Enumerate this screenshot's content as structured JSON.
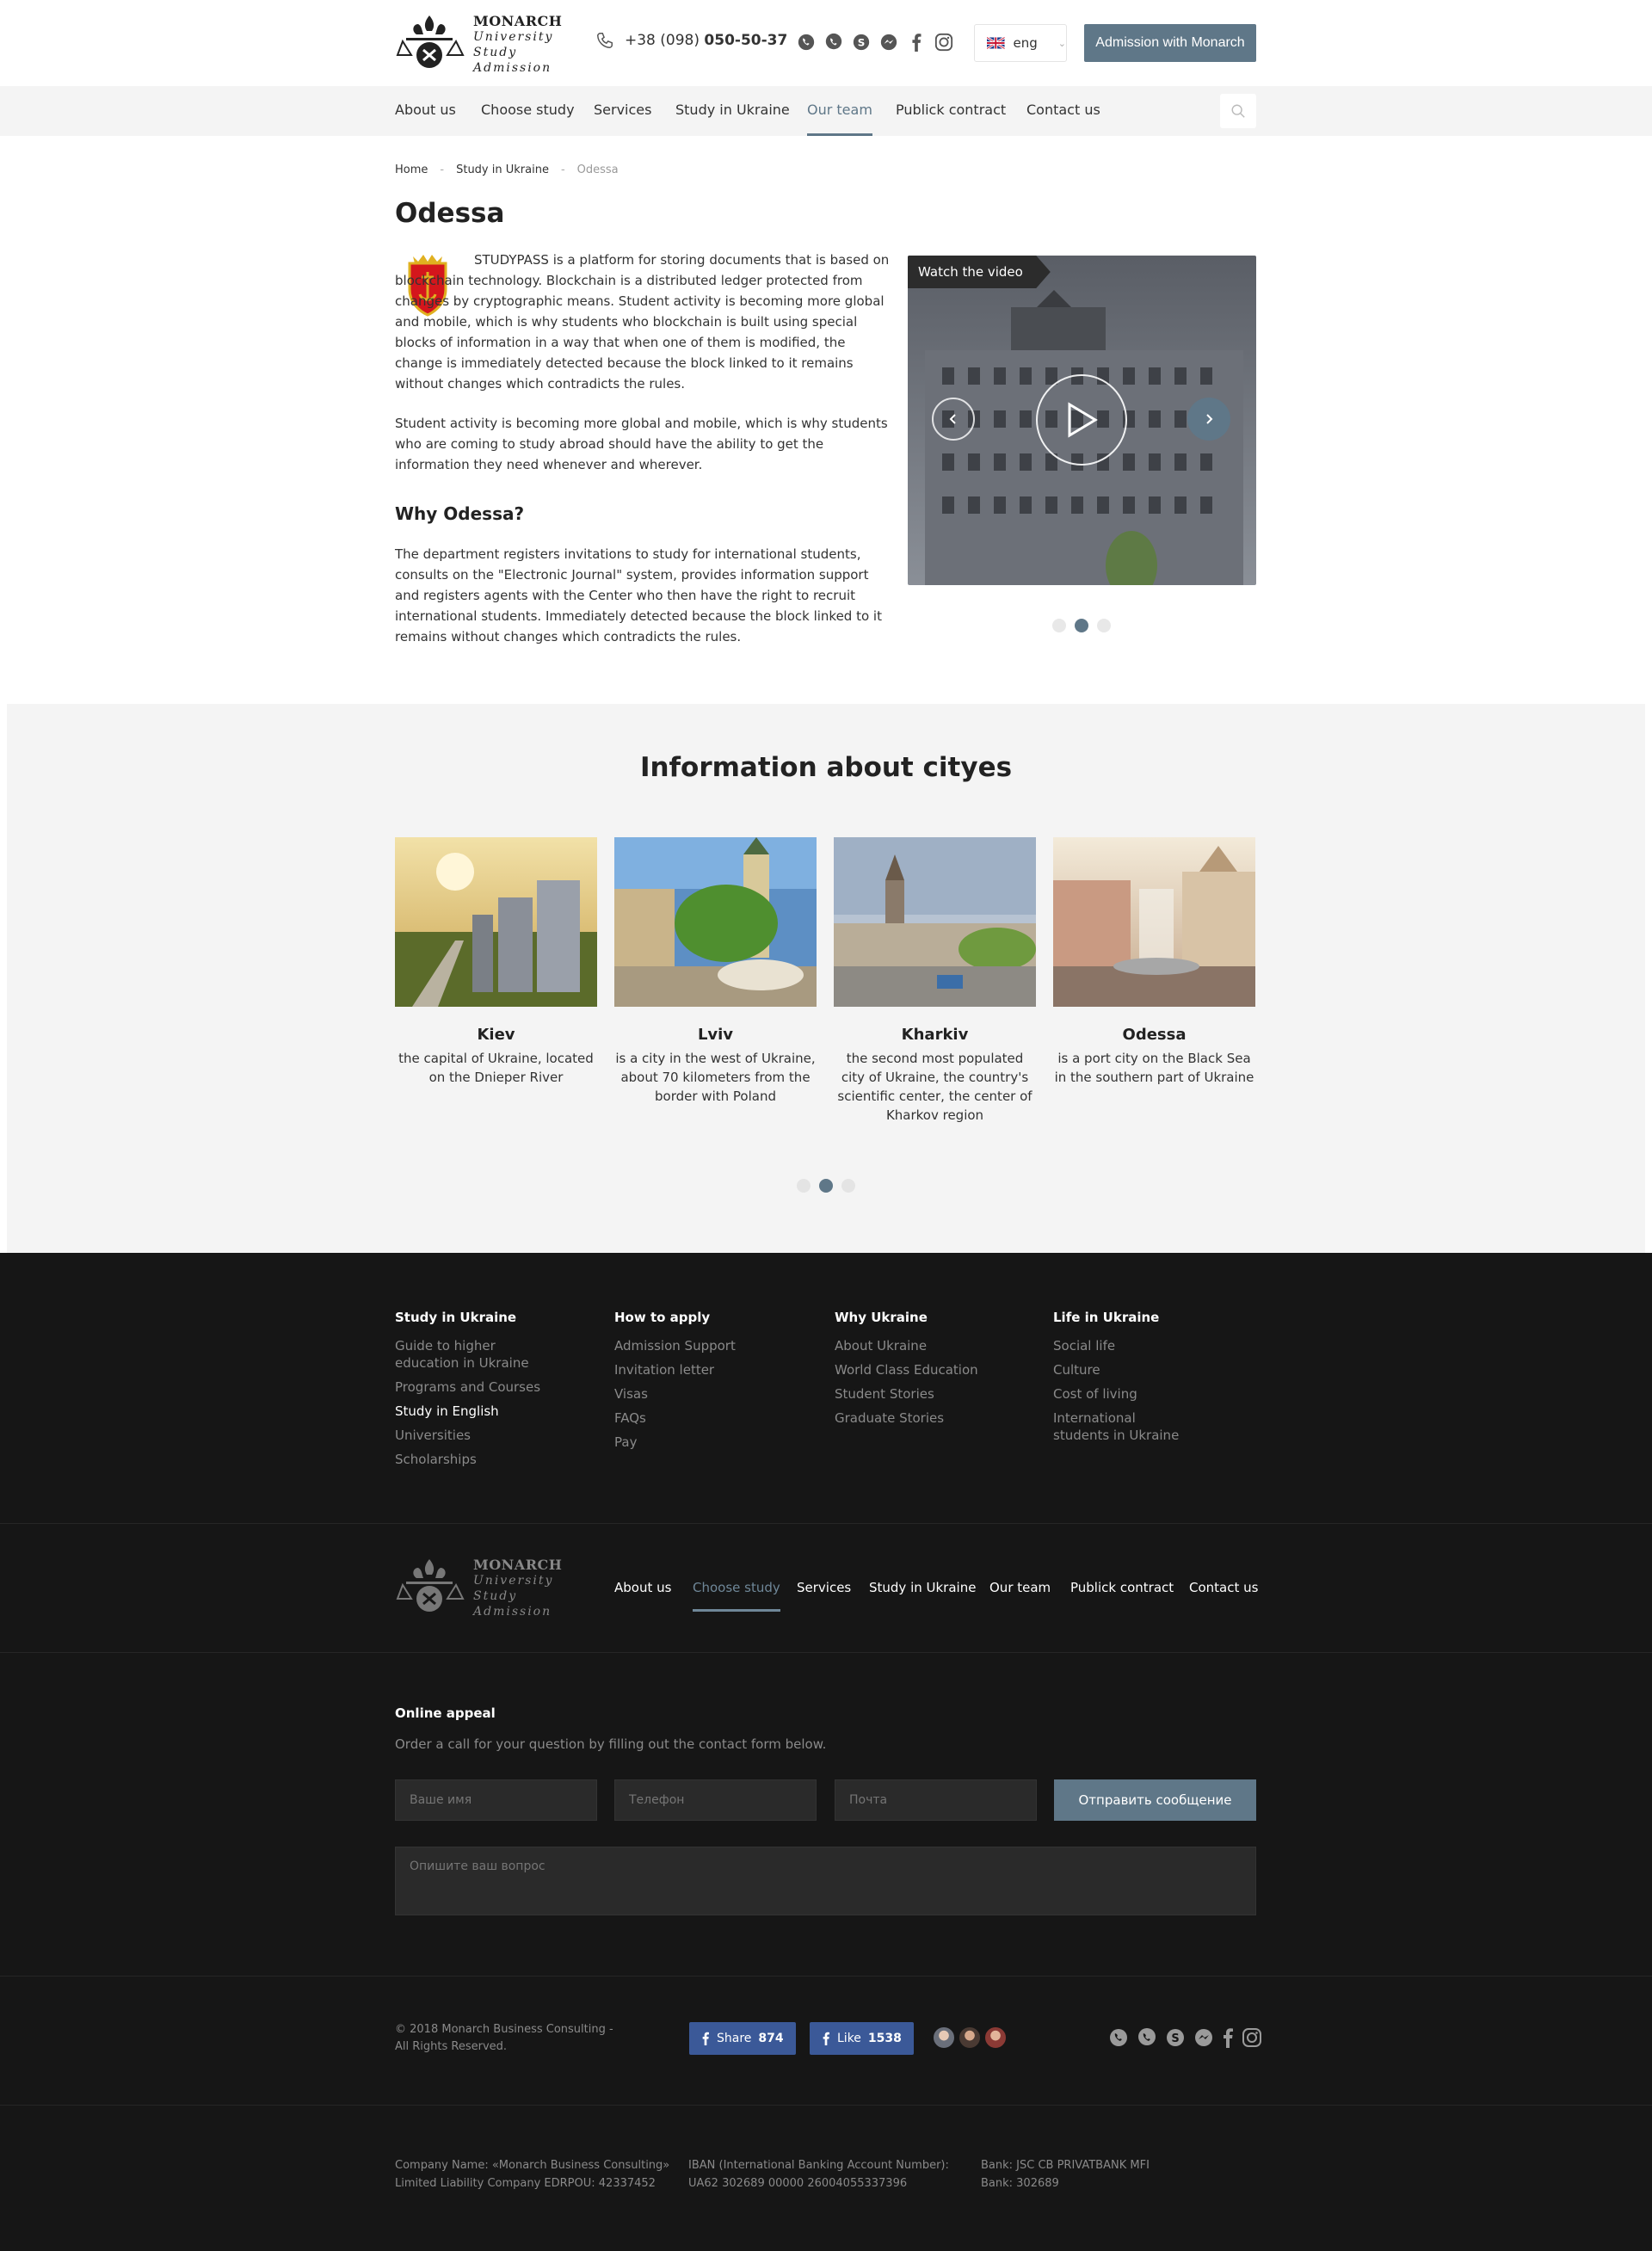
{
  "header": {
    "logo": {
      "line1": "MONARCH",
      "line2": "University",
      "line3": "Study",
      "line4": "Admission"
    },
    "phone_prefix": "+38 (098)",
    "phone_main": "050-50-37",
    "socials": [
      "whatsapp-icon",
      "viber-icon",
      "skype-icon",
      "messenger-icon",
      "facebook-icon",
      "instagram-icon"
    ],
    "lang": "eng",
    "admission_button": "Admission with Monarch"
  },
  "nav": {
    "items": [
      "About us",
      "Choose study",
      "Services",
      "Study in Ukraine",
      "Our team",
      "Publick contract",
      "Contact us"
    ],
    "active": "Our team"
  },
  "breadcrumb": {
    "home": "Home",
    "section": "Study in Ukraine",
    "current": "Odessa",
    "sep": "-"
  },
  "main": {
    "title": "Odessa",
    "para1": "STUDYPASS is a platform for storing documents that is based on blockchain technology. Blockchain is a distributed ledger protected from changes by cryptographic means. Student activity is becoming more global and mobile, which is why students who blockchain is built using special blocks of information in a way that when one of them is modified, the change is immediately detected because the block linked to it remains without changes which contradicts the rules.",
    "para2": "Student activity is becoming more global and mobile, which is why students who are coming to study abroad should have the ability to get the information they need whenever and wherever.",
    "subtitle": "Why Odessa?",
    "para3": "The department registers invitations to study for international students, consults on the \"Electronic Journal\" system, provides information support and registers agents with the Center who then have the right to recruit international students. Immediately detected because the block linked to it remains without changes which contradicts the rules.",
    "video_label": "Watch the video",
    "slider_active": 2,
    "slider_count": 3
  },
  "info": {
    "title": "Information about cityes",
    "cities": [
      {
        "name": "Kiev",
        "desc": "the capital of Ukraine, located on the Dnieper River"
      },
      {
        "name": "Lviv",
        "desc": "is a city in the west of Ukraine, about 70 kilometers from the border with Poland"
      },
      {
        "name": "Kharkiv",
        "desc": "the second most populated city of Ukraine, the country's scientific center, the center of Kharkov region"
      },
      {
        "name": "Odessa",
        "desc": "is a port city on the Black Sea in the southern part of Ukraine"
      }
    ],
    "slider_active": 2,
    "slider_count": 3
  },
  "footer": {
    "columns": [
      {
        "title": "Study in Ukraine",
        "links": [
          "Guide to higher education in Ukraine",
          "Programs and Courses",
          "Study in English",
          "Universities",
          "Scholarships"
        ],
        "highlight": "Study in English"
      },
      {
        "title": "How to apply",
        "links": [
          "Admission Support",
          "Invitation letter",
          "Visas",
          "FAQs",
          "Pay"
        ]
      },
      {
        "title": "Why Ukraine",
        "links": [
          "About Ukraine",
          "World Class Education",
          "Student Stories",
          "Graduate Stories"
        ]
      },
      {
        "title": "Life in Ukraine",
        "links": [
          "Social life",
          "Culture",
          "Cost of living",
          "International students in Ukraine"
        ]
      }
    ],
    "nav": {
      "items": [
        "About us",
        "Choose study",
        "Services",
        "Study in Ukraine",
        "Our team",
        "Publick contract",
        "Contact us"
      ],
      "active": "Choose study"
    },
    "appeal": {
      "title": "Online appeal",
      "text": "Order a call for your question by filling out the contact form below.",
      "name_placeholder": "Ваше имя",
      "phone_placeholder": "Телефон",
      "email_placeholder": "Почта",
      "send_label": "Отправить сообщение",
      "question_placeholder": "Опишите ваш вопрос"
    },
    "copyright": "© 2018 Monarch Business Consulting - All Rights Reserved.",
    "share": {
      "label": "Share",
      "count": "874"
    },
    "like": {
      "label": "Like",
      "count": "1538"
    },
    "bank": {
      "company": "Company Name: «Monarch Business Consulting» Limited Liability Company EDRPOU: 42337452",
      "iban": "IBAN (International Banking Account Number): UA62 302689 00000 26004055337396",
      "bank": "Bank: JSC CB PRIVATBANK MFI Bank: 302689"
    }
  },
  "colors": {
    "accent": "#5f7788",
    "footer_bg": "#161616",
    "section_bg": "#f4f4f4",
    "facebook": "#3b5998"
  }
}
